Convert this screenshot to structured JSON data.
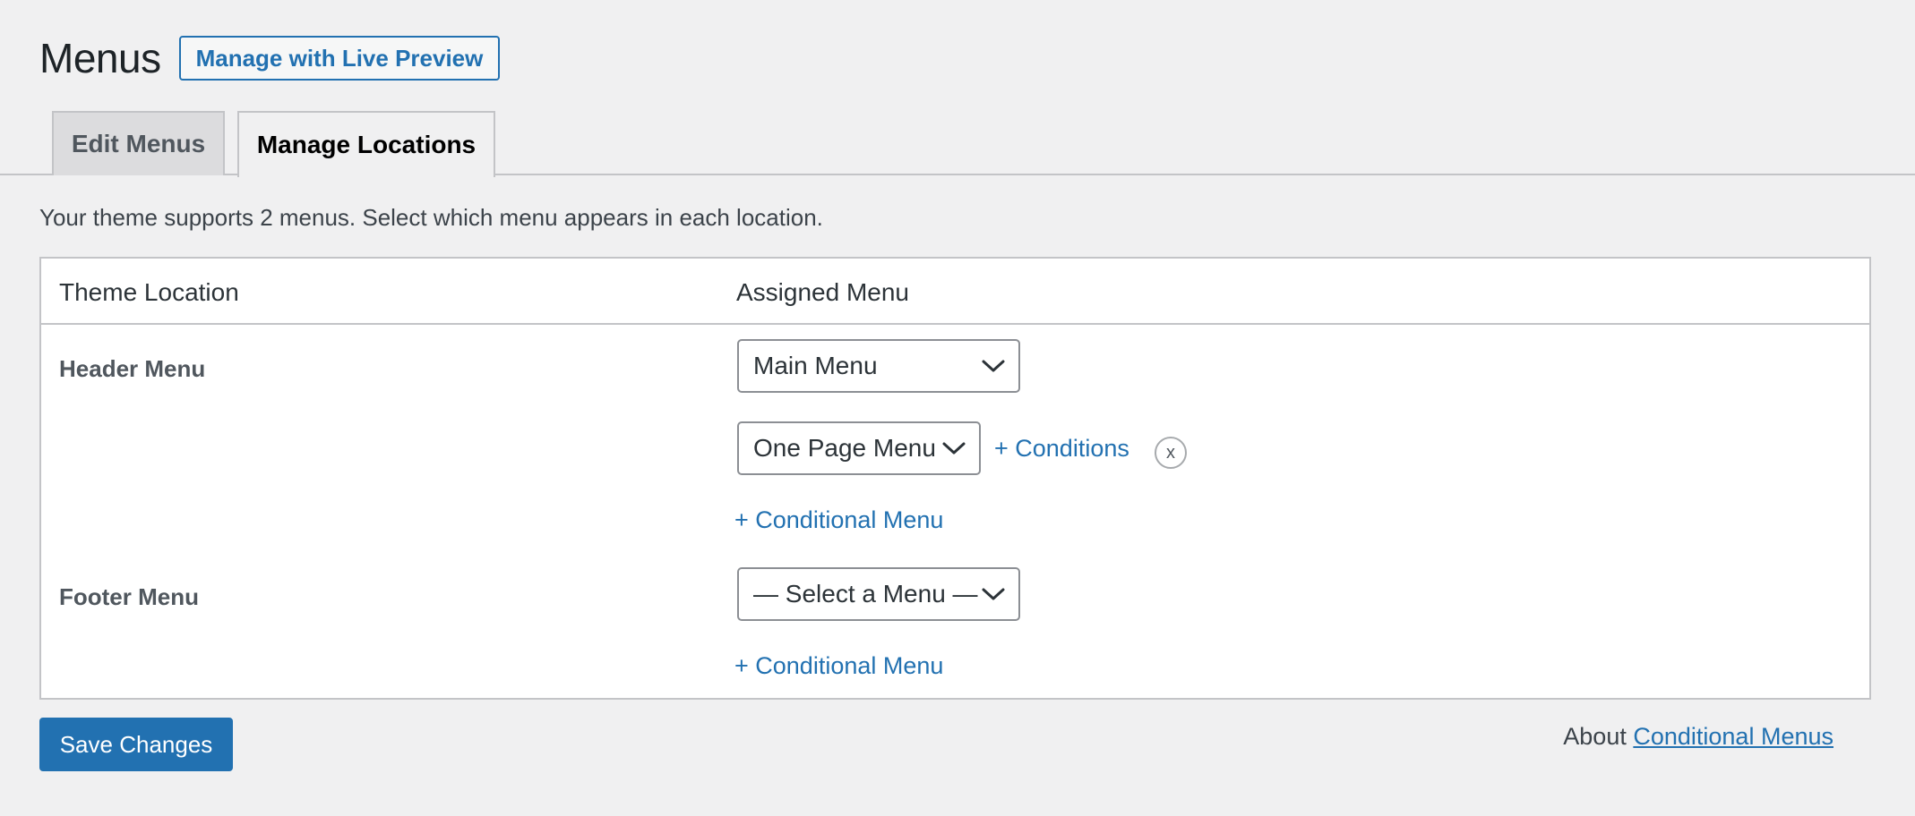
{
  "header": {
    "title": "Menus",
    "live_preview_label": "Manage with Live Preview"
  },
  "tabs": [
    {
      "label": "Edit Menus",
      "active": false
    },
    {
      "label": "Manage Locations",
      "active": true
    }
  ],
  "theme_info": "Your theme supports 2 menus. Select which menu appears in each location.",
  "table": {
    "col_location": "Theme Location",
    "col_menu": "Assigned Menu",
    "rows": [
      {
        "location": "Header Menu",
        "selected_menu": "Main Menu",
        "conditional": {
          "selected_menu": "One Page Menu",
          "conditions_label": "+ Conditions",
          "remove_label": "x"
        },
        "add_conditional_label": "+ Conditional Menu"
      },
      {
        "location": "Footer Menu",
        "selected_menu": "— Select a Menu —",
        "add_conditional_label": "+ Conditional Menu"
      }
    ]
  },
  "footer": {
    "save_label": "Save Changes",
    "about_prefix": "About",
    "about_link": "Conditional Menus"
  },
  "colors": {
    "accent": "#2271b1",
    "background": "#f0f0f1",
    "border": "#c3c4c7"
  },
  "icons": {
    "select_arrow": "chevron-down-icon"
  }
}
